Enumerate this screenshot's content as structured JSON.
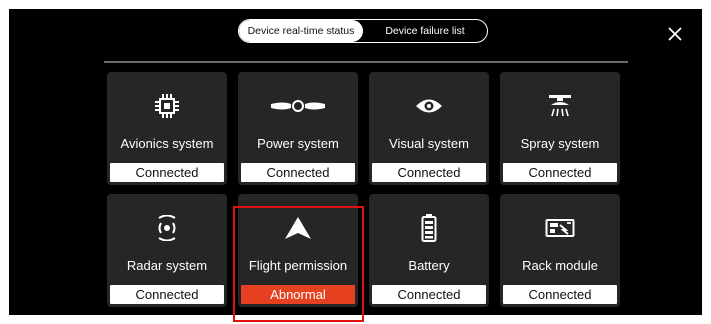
{
  "tabs": [
    {
      "label": "Device real-time status",
      "active": true
    },
    {
      "label": "Device failure list",
      "active": false
    }
  ],
  "close_icon": "close-icon",
  "cards": [
    {
      "label": "Avionics system",
      "status": "Connected",
      "icon": "chip-icon"
    },
    {
      "label": "Power system",
      "status": "Connected",
      "icon": "motor-icon"
    },
    {
      "label": "Visual system",
      "status": "Connected",
      "icon": "eye-icon"
    },
    {
      "label": "Spray system",
      "status": "Connected",
      "icon": "spray-icon"
    },
    {
      "label": "Radar system",
      "status": "Connected",
      "icon": "radar-icon"
    },
    {
      "label": "Flight permission",
      "status": "Abnormal",
      "icon": "arrow-up-icon"
    },
    {
      "label": "Battery",
      "status": "Connected",
      "icon": "battery-icon"
    },
    {
      "label": "Rack module",
      "status": "Connected",
      "icon": "rack-icon"
    }
  ],
  "colors": {
    "background": "#000000",
    "card": "#262626",
    "status_ok": "#ffffff",
    "status_bad": "#e5401f",
    "highlight": "#e01010"
  }
}
